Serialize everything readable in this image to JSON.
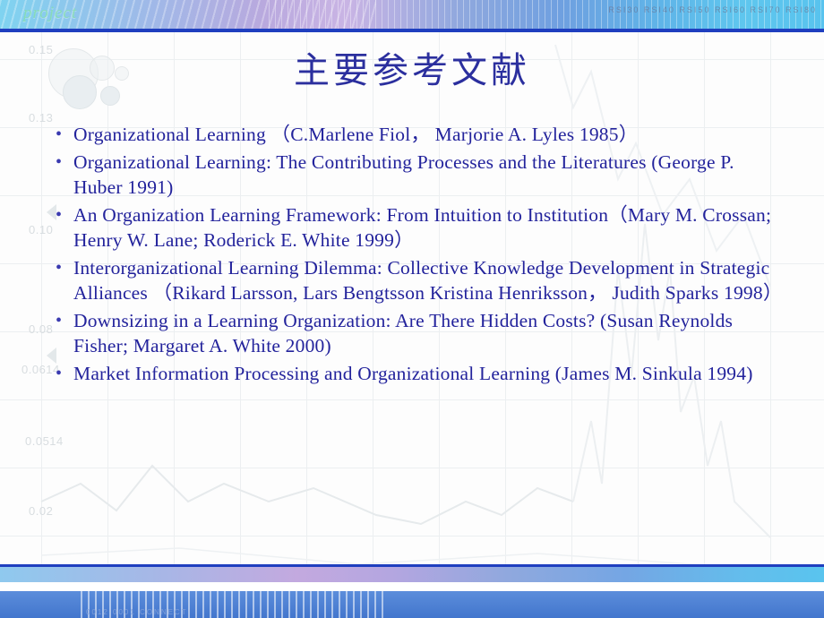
{
  "slide": {
    "title": "主要参考文献",
    "banner": {
      "word": "project",
      "ticks": "RSI30  RSI40  RSI50  RSI60  RSI70  RSI80"
    },
    "footer": {
      "code": "0012  0001  CONNECT"
    },
    "background": {
      "axis_labels": [
        "0.15",
        "0.13",
        "0.10",
        "0.08",
        "0.0614",
        "0.0514",
        "0.02"
      ]
    },
    "bullets": [
      "Organizational Learning （C.Marlene Fiol， Marjorie A. Lyles 1985）",
      "Organizational Learning: The Contributing Processes and the Literatures (George P. Huber 1991)",
      "An Organization Learning Framework: From Intuition to Institution（Mary M. Crossan; Henry W. Lane; Roderick E. White 1999）",
      "Interorganizational Learning Dilemma: Collective Knowledge Development in Strategic Alliances （Rikard Larsson, Lars Bengtsson Kristina Henriksson， Judith Sparks 1998）",
      "Downsizing in a Learning Organization: Are There Hidden Costs? (Susan Reynolds Fisher; Margaret A. White  2000)",
      "Market Information Processing and Organizational Learning (James M. Sinkula 1994)"
    ],
    "bullet_marker": "•"
  }
}
